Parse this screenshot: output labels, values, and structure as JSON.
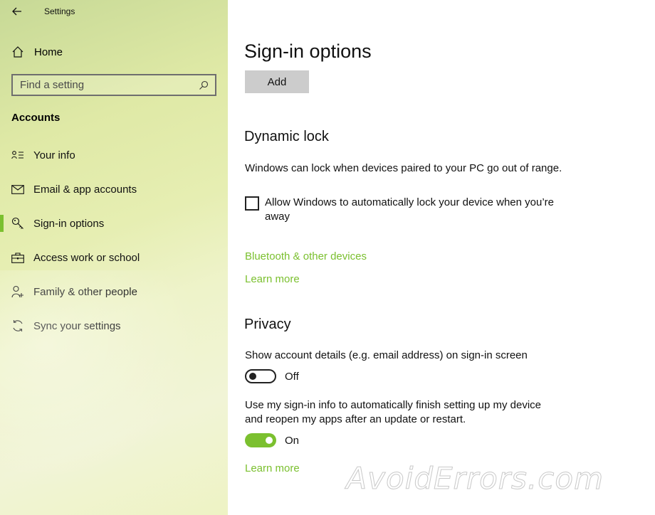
{
  "app": {
    "title": "Settings"
  },
  "sidebar": {
    "home_label": "Home",
    "search_placeholder": "Find a setting",
    "section_title": "Accounts",
    "items": [
      {
        "label": "Your info",
        "icon": "contact-card-icon"
      },
      {
        "label": "Email & app accounts",
        "icon": "mail-icon"
      },
      {
        "label": "Sign-in options",
        "icon": "key-icon",
        "active": true
      },
      {
        "label": "Access work or school",
        "icon": "briefcase-icon"
      },
      {
        "label": "Family & other people",
        "icon": "person-add-icon"
      },
      {
        "label": "Sync your settings",
        "icon": "sync-icon"
      }
    ]
  },
  "main": {
    "title": "Sign-in options",
    "add_button": "Add",
    "dynamic_lock": {
      "heading": "Dynamic lock",
      "description": "Windows can lock when devices paired to your PC go out of range.",
      "checkbox_label": "Allow Windows to automatically lock your device when you’re away",
      "checked": false,
      "link1": "Bluetooth & other devices",
      "link2": "Learn more"
    },
    "privacy": {
      "heading": "Privacy",
      "setting1_label": "Show account details (e.g. email address) on sign-in screen",
      "setting1_state": "Off",
      "setting2_label": "Use my sign-in info to automatically finish setting up my device and reopen my apps after an update or restart.",
      "setting2_state": "On",
      "link": "Learn more"
    }
  },
  "watermark": "AvoidErrors.com",
  "colors": {
    "accent": "#7bc02f",
    "button_bg": "#cccccc"
  }
}
